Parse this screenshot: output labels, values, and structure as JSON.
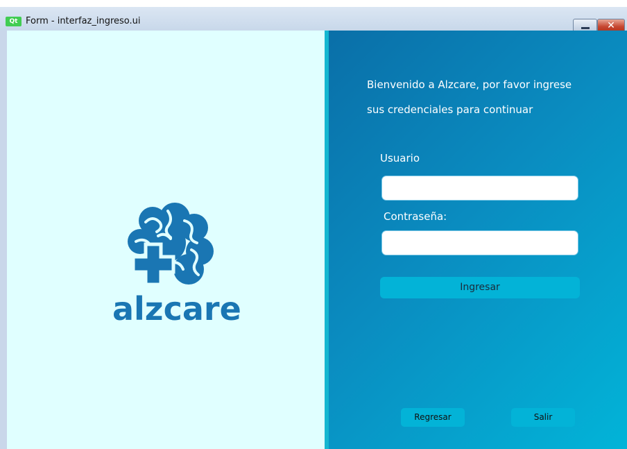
{
  "window": {
    "title": "Form - interfaz_ingreso.ui",
    "app_badge": "Qt",
    "close_glyph": "✕"
  },
  "brand": {
    "name": "alzcare",
    "logo_icon": "brain-cross-icon",
    "color": "#1a76b3"
  },
  "login": {
    "welcome_line1": "Bienvenido a Alzcare, por favor ingrese",
    "welcome_line2": "sus credenciales para continuar",
    "user_label": "Usuario",
    "user_value": "",
    "password_label": "Contraseña:",
    "password_value": "",
    "submit_label": "Ingresar"
  },
  "footer": {
    "back_label": "Regresar",
    "exit_label": "Salir"
  },
  "colors": {
    "left_panel_bg": "#e0ffff",
    "right_panel_start": "#0a6fa8",
    "right_panel_end": "#02b4d8",
    "button_bg": "#03b3d7"
  }
}
